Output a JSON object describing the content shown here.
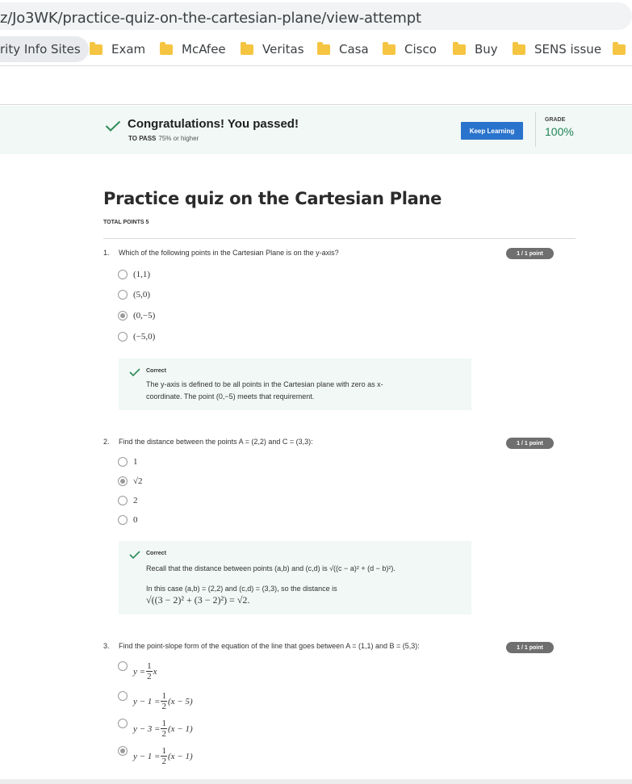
{
  "browser": {
    "url": "z/Jo3WK/practice-quiz-on-the-cartesian-plane/view-attempt",
    "bookmarks": [
      "rity Info Sites",
      "Exam",
      "McAfee",
      "Veritas",
      "Casa",
      "Cisco",
      "Buy",
      "SENS issue"
    ]
  },
  "banner": {
    "title": "Congratulations! You passed!",
    "to_pass_label": "TO PASS",
    "to_pass_value": "75% or higher",
    "keep_learning": "Keep Learning",
    "grade_label": "GRADE",
    "grade_value": "100%"
  },
  "quiz": {
    "title": "Practice quiz on the Cartesian Plane",
    "total_points": "TOTAL POINTS 5",
    "questions": [
      {
        "number": "1.",
        "text": "Which of the following points in the Cartesian Plane is on the y-axis?",
        "points": "1 / 1 point",
        "options": [
          "(1,1)",
          "(5,0)",
          "(0,−5)",
          "(−5,0)"
        ],
        "selected": 2,
        "feedback_head": "Correct",
        "feedback_line1": "The y-axis is defined to be all points in the Cartesian plane with zero as x-",
        "feedback_line2": "coordinate. The point (0,−5) meets that requirement."
      },
      {
        "number": "2.",
        "text": "Find the distance between the points A = (2,2) and C = (3,3):",
        "points": "1 / 1 point",
        "options": [
          "1",
          "√2",
          "2",
          "0"
        ],
        "selected": 1,
        "feedback_head": "Correct",
        "feedback_line1": "Recall that the distance between points (a,b) and (c,d) is √((c − a)² + (d − b)²).",
        "feedback_line2": "In this case (a,b) = (2,2) and (c,d) = (3,3), so the distance is",
        "feedback_line3": "√((3 − 2)² + (3 − 2)²) = √2."
      },
      {
        "number": "3.",
        "text": "Find the point-slope form of the equation of the line that goes between A = (1,1) and B = (5,3):",
        "points": "1 / 1 point",
        "options": [
          {
            "left": "y =",
            "num": "1",
            "den": "2",
            "right": "x"
          },
          {
            "left": "y − 1 =",
            "num": "1",
            "den": "2",
            "right": "(x − 5)"
          },
          {
            "left": "y − 3 =",
            "num": "1",
            "den": "2",
            "right": "(x − 1)"
          },
          {
            "left": "y − 1 =",
            "num": "1",
            "den": "2",
            "right": "(x − 1)"
          }
        ],
        "selected": 3
      }
    ]
  },
  "colors": {
    "banner_bg": "#f1f8f6",
    "button_blue": "#2a73cc",
    "grade_green": "#1f8354",
    "check_green": "#2e8b57",
    "pill_gray": "#6f6f6f"
  }
}
